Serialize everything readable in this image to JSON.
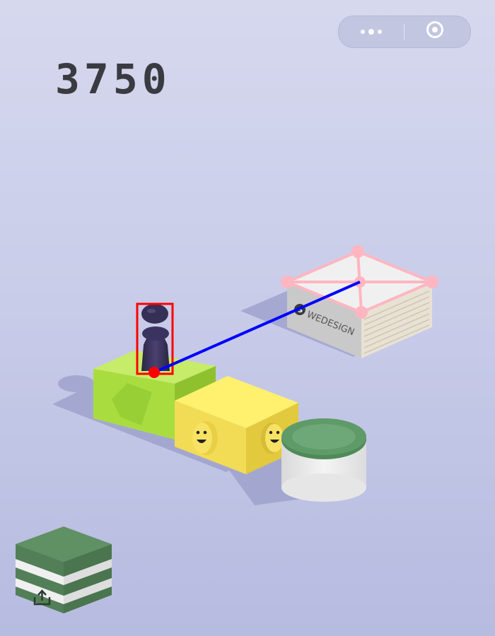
{
  "game": {
    "score": "3750"
  },
  "next_block": {
    "brand_text": "WEDESIGN",
    "brand_logo_glyph": "S"
  },
  "colors": {
    "background_top": "#d6d8ee",
    "background_bottom": "#b6bbe0",
    "score_text": "#3a3b41",
    "player": "#3d355e",
    "current_block": "#a9dd3f",
    "yellow_block": "#ffe95b",
    "can_lid": "#5e9b68",
    "target_block": "#f0f0f0",
    "annotation_box": "#ff0000",
    "trajectory_line": "#0000ff",
    "target_outline": "#ffb6c1"
  },
  "icons": {
    "capsule_more": "more-dots-icon",
    "capsule_close": "close-target-icon",
    "share": "share-icon"
  }
}
